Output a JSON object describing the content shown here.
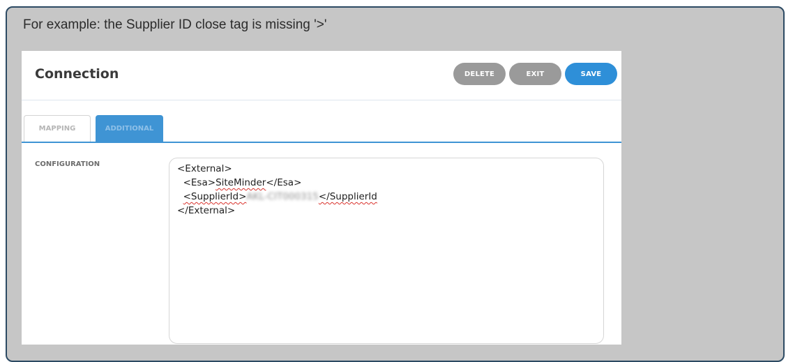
{
  "caption": "For example: the Supplier ID close tag is missing '>'",
  "panel": {
    "title": "Connection",
    "buttons": {
      "delete": "DELETE",
      "exit": "EXIT",
      "save": "SAVE"
    },
    "tabs": [
      {
        "label": "MAPPING",
        "active": false
      },
      {
        "label": "ADDITIONAL",
        "active": true
      }
    ],
    "configuration": {
      "label": "CONFIGURATION",
      "lines": {
        "open_external": "<External>",
        "esa_open": "<Esa>",
        "esa_value": "SiteMinder",
        "esa_close": "</Esa>",
        "supplier_open": "<SupplierId>",
        "supplier_value_redacted": "AKL-CIT000315",
        "supplier_close": "</SupplierId",
        "close_external": "</External>"
      }
    }
  },
  "colors": {
    "accent": "#3f94d4",
    "save_button": "#2e8fd8",
    "neutral_button": "#9a9a9a",
    "callout_background": "#c6c6c6",
    "callout_border": "#2c4a63",
    "spellcheck_underline": "#d9312b"
  }
}
